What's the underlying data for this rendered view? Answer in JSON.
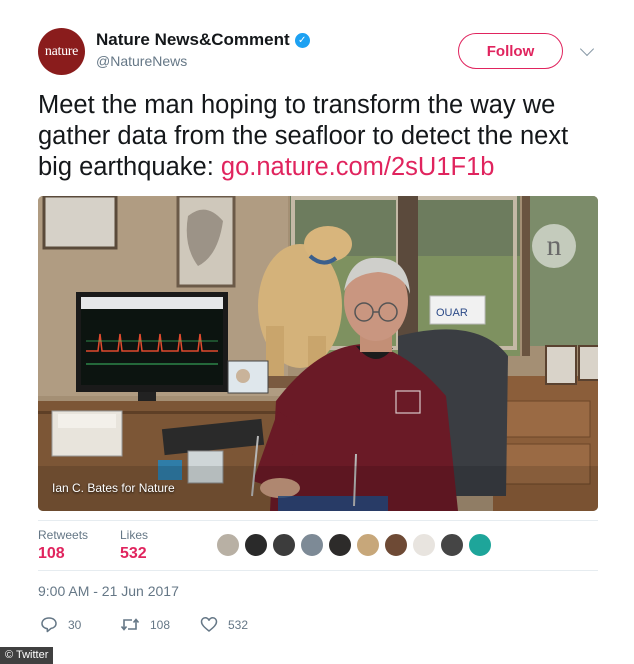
{
  "account": {
    "avatar_text": "nature",
    "display_name": "Nature News&Comment",
    "handle": "@NatureNews",
    "follow_label": "Follow"
  },
  "tweet": {
    "text": "Meet the man hoping to transform the way we gather data from the seafloor to detect the next big earthquake: ",
    "link": "go.nature.com/2sU1F1b"
  },
  "photo": {
    "credit": "Ian C. Bates for Nature",
    "logo_text": "n"
  },
  "stats": {
    "retweets_label": "Retweets",
    "retweets_value": "108",
    "likes_label": "Likes",
    "likes_value": "532",
    "liker_colors": [
      "#b8b0a4",
      "#2a2a2a",
      "#3c3c3c",
      "#7d8a96",
      "#2d2b2a",
      "#c7a77a",
      "#6e4a35",
      "#e8e4df",
      "#454545",
      "#1ea59a"
    ]
  },
  "timestamp": "9:00 AM - 21 Jun 2017",
  "actions": {
    "replies": "30",
    "retweets": "108",
    "likes": "532"
  },
  "footer": {
    "watermark": "© Twitter"
  },
  "colors": {
    "accent": "#e0245e",
    "verified": "#1da1f2",
    "muted": "#657786"
  }
}
